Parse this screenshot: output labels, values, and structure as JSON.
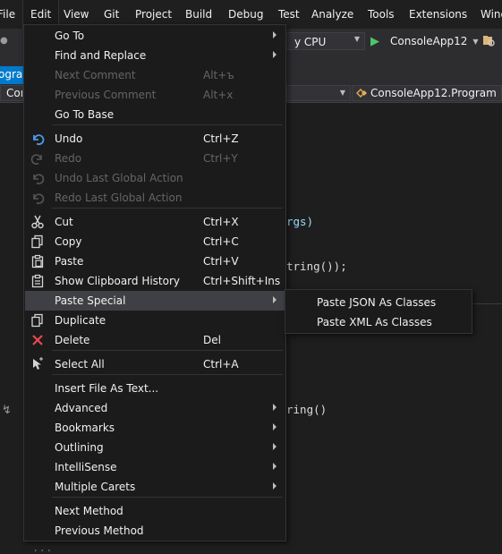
{
  "menubar": {
    "items": [
      {
        "label": "File"
      },
      {
        "label": "Edit"
      },
      {
        "label": "View"
      },
      {
        "label": "Git"
      },
      {
        "label": "Project"
      },
      {
        "label": "Build"
      },
      {
        "label": "Debug"
      },
      {
        "label": "Test"
      },
      {
        "label": "Analyze"
      },
      {
        "label": "Tools"
      },
      {
        "label": "Extensions"
      },
      {
        "label": "Wind"
      }
    ],
    "active": "Edit"
  },
  "toolbar": {
    "platform_value": "y CPU",
    "run_label": "ConsoleApp12"
  },
  "tabs": {
    "active_tab_label": "ogra"
  },
  "navbar": {
    "left_label": "Con",
    "right_label": "ConsoleApp12.Program"
  },
  "editor": {
    "line1": "rgs)",
    "line2": "tring());",
    "line3": "ring()",
    "bottom": "..."
  },
  "edit_menu": {
    "items": [
      {
        "label": "Go To",
        "shortcut": "",
        "icon": "",
        "submenu": true,
        "enabled": true
      },
      {
        "label": "Find and Replace",
        "shortcut": "",
        "icon": "",
        "submenu": true,
        "enabled": true
      },
      {
        "label": "Next Comment",
        "shortcut": "Alt+ъ",
        "icon": "",
        "submenu": false,
        "enabled": false
      },
      {
        "label": "Previous Comment",
        "shortcut": "Alt+x",
        "icon": "",
        "submenu": false,
        "enabled": false
      },
      {
        "label": "Go To Base",
        "shortcut": "",
        "icon": "",
        "submenu": false,
        "enabled": true
      },
      {
        "label": "Undo",
        "shortcut": "Ctrl+Z",
        "icon": "undo-icon",
        "submenu": false,
        "enabled": true
      },
      {
        "label": "Redo",
        "shortcut": "Ctrl+Y",
        "icon": "redo-icon",
        "submenu": false,
        "enabled": false
      },
      {
        "label": "Undo Last Global Action",
        "shortcut": "",
        "icon": "undo-global-icon",
        "submenu": false,
        "enabled": false
      },
      {
        "label": "Redo Last Global Action",
        "shortcut": "",
        "icon": "redo-global-icon",
        "submenu": false,
        "enabled": false
      },
      {
        "label": "Cut",
        "shortcut": "Ctrl+X",
        "icon": "scissors-icon",
        "submenu": false,
        "enabled": true
      },
      {
        "label": "Copy",
        "shortcut": "Ctrl+C",
        "icon": "copy-icon",
        "submenu": false,
        "enabled": true
      },
      {
        "label": "Paste",
        "shortcut": "Ctrl+V",
        "icon": "paste-icon",
        "submenu": false,
        "enabled": true
      },
      {
        "label": "Show Clipboard History",
        "shortcut": "Ctrl+Shift+Ins",
        "icon": "clipboard-history-icon",
        "submenu": false,
        "enabled": true
      },
      {
        "label": "Paste Special",
        "shortcut": "",
        "icon": "",
        "submenu": true,
        "enabled": true
      },
      {
        "label": "Duplicate",
        "shortcut": "",
        "icon": "duplicate-icon",
        "submenu": false,
        "enabled": true
      },
      {
        "label": "Delete",
        "shortcut": "Del",
        "icon": "delete-x-icon",
        "submenu": false,
        "enabled": true
      },
      {
        "label": "Select All",
        "shortcut": "Ctrl+A",
        "icon": "select-all-icon",
        "submenu": false,
        "enabled": true
      },
      {
        "label": "Insert File As Text...",
        "shortcut": "",
        "icon": "",
        "submenu": false,
        "enabled": true
      },
      {
        "label": "Advanced",
        "shortcut": "",
        "icon": "",
        "submenu": true,
        "enabled": true
      },
      {
        "label": "Bookmarks",
        "shortcut": "",
        "icon": "",
        "submenu": true,
        "enabled": true
      },
      {
        "label": "Outlining",
        "shortcut": "",
        "icon": "",
        "submenu": true,
        "enabled": true
      },
      {
        "label": "IntelliSense",
        "shortcut": "",
        "icon": "",
        "submenu": true,
        "enabled": true
      },
      {
        "label": "Multiple Carets",
        "shortcut": "",
        "icon": "",
        "submenu": true,
        "enabled": true
      },
      {
        "label": "Next Method",
        "shortcut": "",
        "icon": "",
        "submenu": false,
        "enabled": true
      },
      {
        "label": "Previous Method",
        "shortcut": "",
        "icon": "",
        "submenu": false,
        "enabled": true
      }
    ],
    "highlighted": "Paste Special"
  },
  "paste_special_menu": {
    "items": [
      {
        "label": "Paste JSON As Classes"
      },
      {
        "label": "Paste XML As Classes"
      }
    ]
  }
}
